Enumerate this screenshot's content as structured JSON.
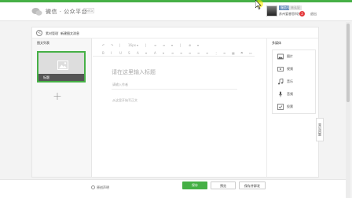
{
  "header": {
    "app_title": "微信 · 公众平台",
    "app_badge": "beta",
    "user_badge": "服务号",
    "user_badge2": "未认证",
    "user_name": "苏州爱睿思科技",
    "msg_count": "2",
    "logout_label": "退出"
  },
  "breadcrumb": {
    "back_label": "<",
    "level1": "素材管理",
    "separator": "/",
    "level2": "新建图文消息"
  },
  "left_panel": {
    "title": "图文列表",
    "card_title": "标题",
    "add_label": "+"
  },
  "toolbar": {
    "row1": [
      "↶",
      "↷",
      "|",
      "16px",
      "▾",
      "|",
      "≡",
      "≡",
      "▾",
      "|",
      "⊕",
      "▾"
    ],
    "row2": [
      "B",
      "I",
      "U",
      "S",
      "A",
      "▾",
      "A",
      "▾",
      "≡",
      "≡",
      "≡",
      "≡",
      "≡",
      "⋮",
      "≡",
      "▦",
      "⚑",
      "▭"
    ]
  },
  "editor": {
    "title_placeholder": "请在这里输入标题",
    "author_placeholder": "请输入作者",
    "body_placeholder": "从这里开始写正文"
  },
  "right_panel": {
    "title": "多媒体",
    "items": [
      {
        "icon": "image-icon",
        "label": "图片"
      },
      {
        "icon": "video-icon",
        "label": "视频"
      },
      {
        "icon": "music-icon",
        "label": "音乐"
      },
      {
        "icon": "voice-icon",
        "label": "音频"
      },
      {
        "icon": "vote-icon",
        "label": "投票"
      }
    ]
  },
  "side_tab": "常见问题",
  "footer": {
    "original_label": "原创声明",
    "save_label": "保存",
    "preview_label": "预览",
    "send_label": "保存并群发"
  },
  "colors": {
    "brand_green": "#46b046",
    "badge_red": "#e4393c"
  }
}
